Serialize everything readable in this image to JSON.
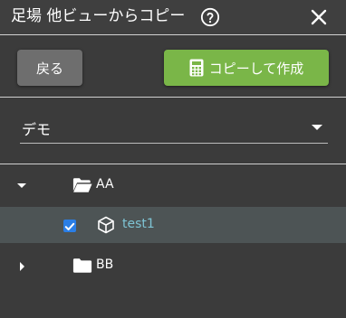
{
  "header": {
    "title": "足場 他ビューからコピー",
    "help_icon": "help-circle-icon",
    "close_icon": "close-icon"
  },
  "toolbar": {
    "back_label": "戻る",
    "copy_label": "コピーして作成",
    "copy_icon": "calculator-icon",
    "copy_button_color": "#7ab648",
    "back_button_color": "#6e6e6e"
  },
  "selector": {
    "selected": "デモ"
  },
  "tree": {
    "nodes": [
      {
        "label": "AA",
        "type": "folder-open",
        "expanded": true,
        "children": [
          {
            "label": "test1",
            "type": "model",
            "checked": true
          }
        ]
      },
      {
        "label": "BB",
        "type": "folder",
        "expanded": false
      }
    ],
    "selected_row_color": "#4d5455",
    "link_color": "#7ec4d4"
  }
}
